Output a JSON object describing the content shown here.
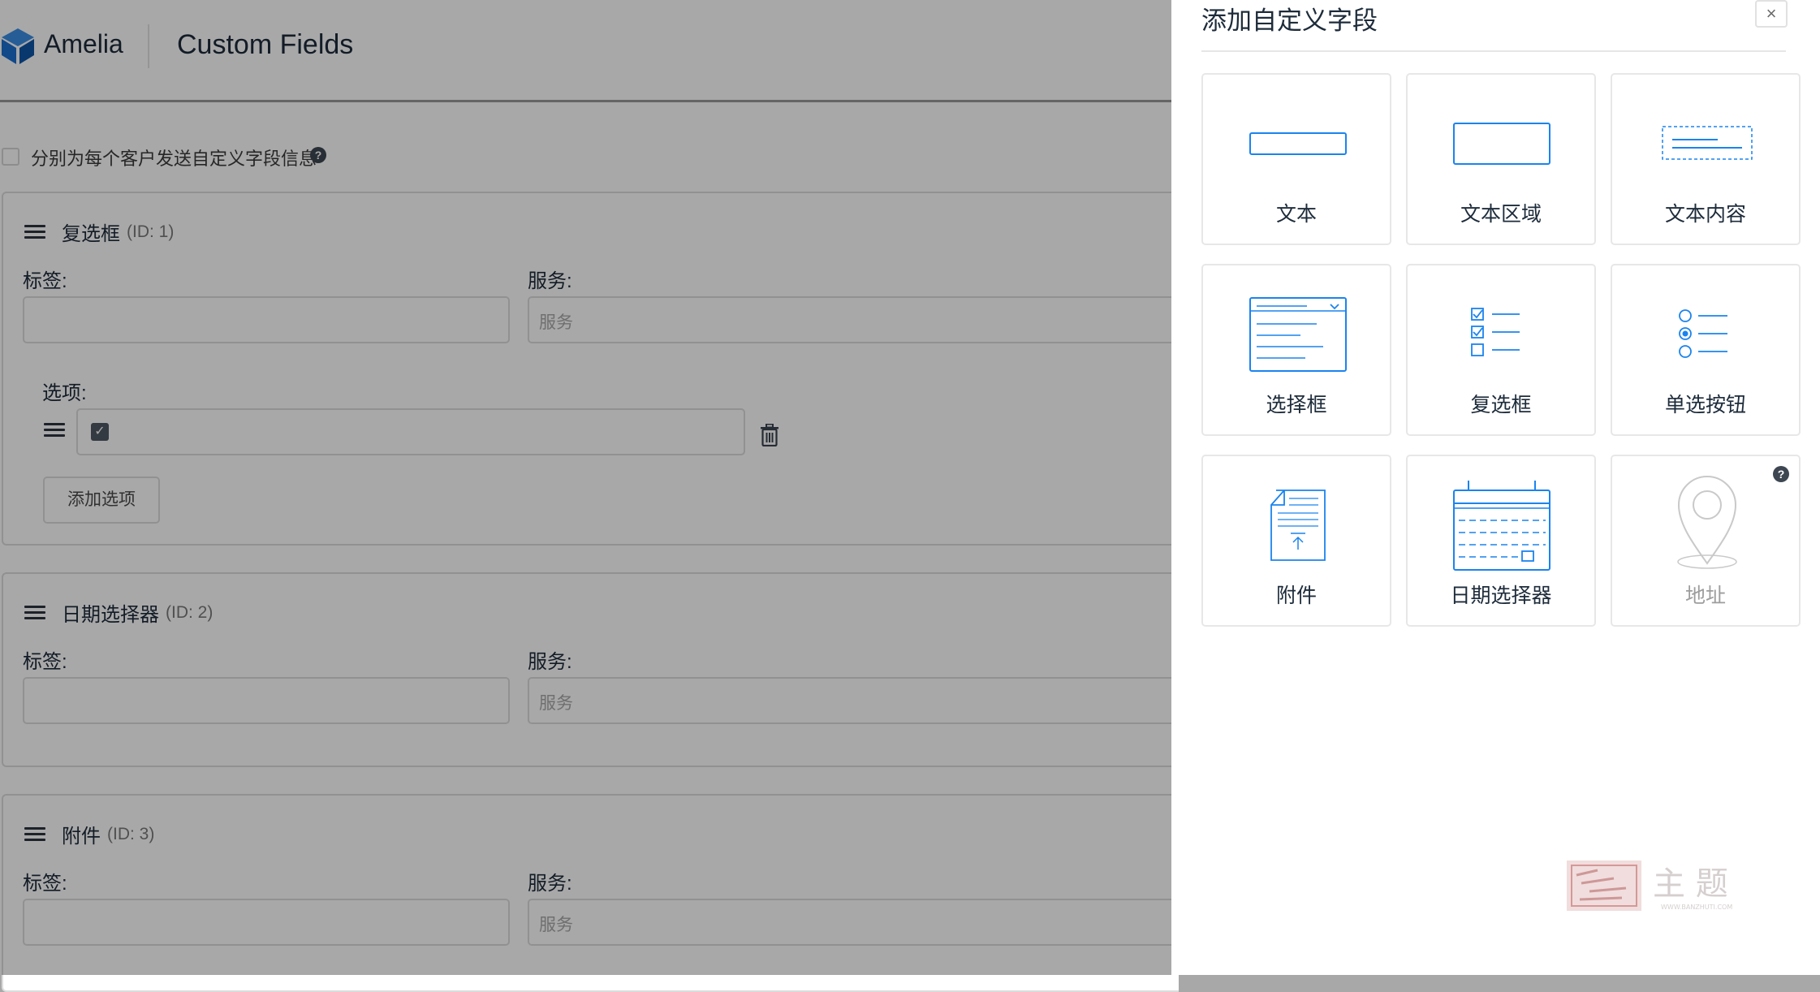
{
  "header": {
    "app_name": "Amelia",
    "page_title": "Custom Fields"
  },
  "settings": {
    "send_separately_label": "分别为每个客户发送自定义字段信息",
    "help_glyph": "?"
  },
  "fields": [
    {
      "type_label": "复选框",
      "id_label": "(ID: 1)",
      "label_caption": "标签:",
      "services_caption": "服务:",
      "services_placeholder": "服务",
      "options_caption": "选项:",
      "add_option_label": "添加选项"
    },
    {
      "type_label": "日期选择器",
      "id_label": "(ID: 2)",
      "label_caption": "标签:",
      "services_caption": "服务:",
      "services_placeholder": "服务"
    },
    {
      "type_label": "附件",
      "id_label": "(ID: 3)",
      "label_caption": "标签:",
      "services_caption": "服务:",
      "services_placeholder": "服务"
    }
  ],
  "panel": {
    "title": "添加自定义字段",
    "close_glyph": "×",
    "field_types": [
      {
        "label": "文本",
        "icon": "text-input-icon"
      },
      {
        "label": "文本区域",
        "icon": "textarea-icon"
      },
      {
        "label": "文本内容",
        "icon": "text-content-icon"
      },
      {
        "label": "选择框",
        "icon": "select-box-icon"
      },
      {
        "label": "复选框",
        "icon": "checkbox-list-icon"
      },
      {
        "label": "单选按钮",
        "icon": "radio-buttons-icon"
      },
      {
        "label": "附件",
        "icon": "attachment-icon"
      },
      {
        "label": "日期选择器",
        "icon": "date-picker-icon"
      },
      {
        "label": "地址",
        "icon": "address-pin-icon",
        "disabled": true
      }
    ]
  },
  "watermark": {
    "text": "主 题",
    "sub": "WWW.BANZHUTI.COM"
  },
  "colors": {
    "accent": "#1a84ee",
    "dark_text": "#1d2b3a",
    "border": "#e7e7e7",
    "logo_blue": "#1a6fd1"
  }
}
